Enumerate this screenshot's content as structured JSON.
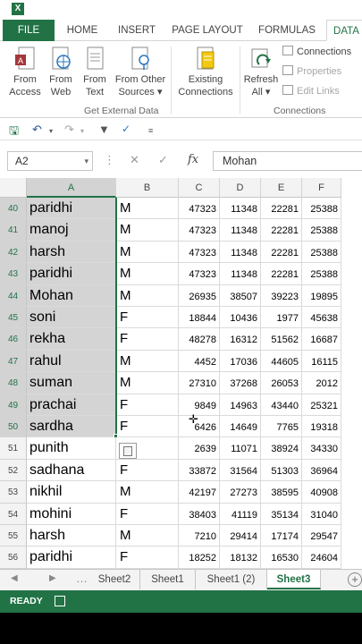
{
  "app": {
    "logo": "X"
  },
  "ribbon_tabs": [
    "FILE",
    "HOME",
    "INSERT",
    "PAGE LAYOUT",
    "FORMULAS",
    "DATA"
  ],
  "ribbon": {
    "from_access": "From\nAccess",
    "from_web": "From\nWeb",
    "from_text": "From\nText",
    "from_other": "From Other\nSources ▾",
    "existing": "Existing\nConnections",
    "group1": "Get External Data",
    "refresh": "Refresh\nAll ▾",
    "connections": "Connections",
    "properties": "Properties",
    "edit_links": "Edit Links",
    "group2": "Connections"
  },
  "formula_bar": {
    "name_box": "A2",
    "fx": "fx",
    "value": "Mohan"
  },
  "columns": [
    "A",
    "B",
    "C",
    "D",
    "E",
    "F"
  ],
  "rows": [
    {
      "n": "40",
      "a": "paridhi",
      "b": "M",
      "c": "47323",
      "d": "11348",
      "e": "22281",
      "f": "25388"
    },
    {
      "n": "41",
      "a": "manoj",
      "b": "M",
      "c": "47323",
      "d": "11348",
      "e": "22281",
      "f": "25388"
    },
    {
      "n": "42",
      "a": "harsh",
      "b": "M",
      "c": "47323",
      "d": "11348",
      "e": "22281",
      "f": "25388"
    },
    {
      "n": "43",
      "a": "paridhi",
      "b": "M",
      "c": "47323",
      "d": "11348",
      "e": "22281",
      "f": "25388"
    },
    {
      "n": "44",
      "a": "Mohan",
      "b": "M",
      "c": "26935",
      "d": "38507",
      "e": "39223",
      "f": "19895"
    },
    {
      "n": "45",
      "a": "soni",
      "b": "F",
      "c": "18844",
      "d": "10436",
      "e": "1977",
      "f": "45638"
    },
    {
      "n": "46",
      "a": "rekha",
      "b": "F",
      "c": "48278",
      "d": "16312",
      "e": "51562",
      "f": "16687"
    },
    {
      "n": "47",
      "a": "rahul",
      "b": "M",
      "c": "4452",
      "d": "17036",
      "e": "44605",
      "f": "16115"
    },
    {
      "n": "48",
      "a": "suman",
      "b": "M",
      "c": "27310",
      "d": "37268",
      "e": "26053",
      "f": "2012"
    },
    {
      "n": "49",
      "a": "prachai",
      "b": "F",
      "c": "9849",
      "d": "14963",
      "e": "43440",
      "f": "25321"
    },
    {
      "n": "50",
      "a": "sardha",
      "b": "F",
      "c": "6426",
      "d": "14649",
      "e": "7765",
      "f": "19318"
    },
    {
      "n": "51",
      "a": "punith",
      "b": "",
      "c": "2639",
      "d": "11071",
      "e": "38924",
      "f": "34330"
    },
    {
      "n": "52",
      "a": "sadhana",
      "b": "F",
      "c": "33872",
      "d": "31564",
      "e": "51303",
      "f": "36964"
    },
    {
      "n": "53",
      "a": "nikhil",
      "b": "M",
      "c": "42197",
      "d": "27273",
      "e": "38595",
      "f": "40908"
    },
    {
      "n": "54",
      "a": "mohini",
      "b": "F",
      "c": "38403",
      "d": "41119",
      "e": "35134",
      "f": "31040"
    },
    {
      "n": "55",
      "a": "harsh",
      "b": "M",
      "c": "7210",
      "d": "29414",
      "e": "17174",
      "f": "29547"
    },
    {
      "n": "56",
      "a": "paridhi",
      "b": "F",
      "c": "18252",
      "d": "18132",
      "e": "16530",
      "f": "24604"
    }
  ],
  "sheet_tabs": [
    "Sheet2",
    "Sheet1",
    "Sheet1 (2)",
    "Sheet3"
  ],
  "active_sheet": "Sheet3",
  "status": "READY",
  "colors": {
    "accent": "#217346"
  }
}
